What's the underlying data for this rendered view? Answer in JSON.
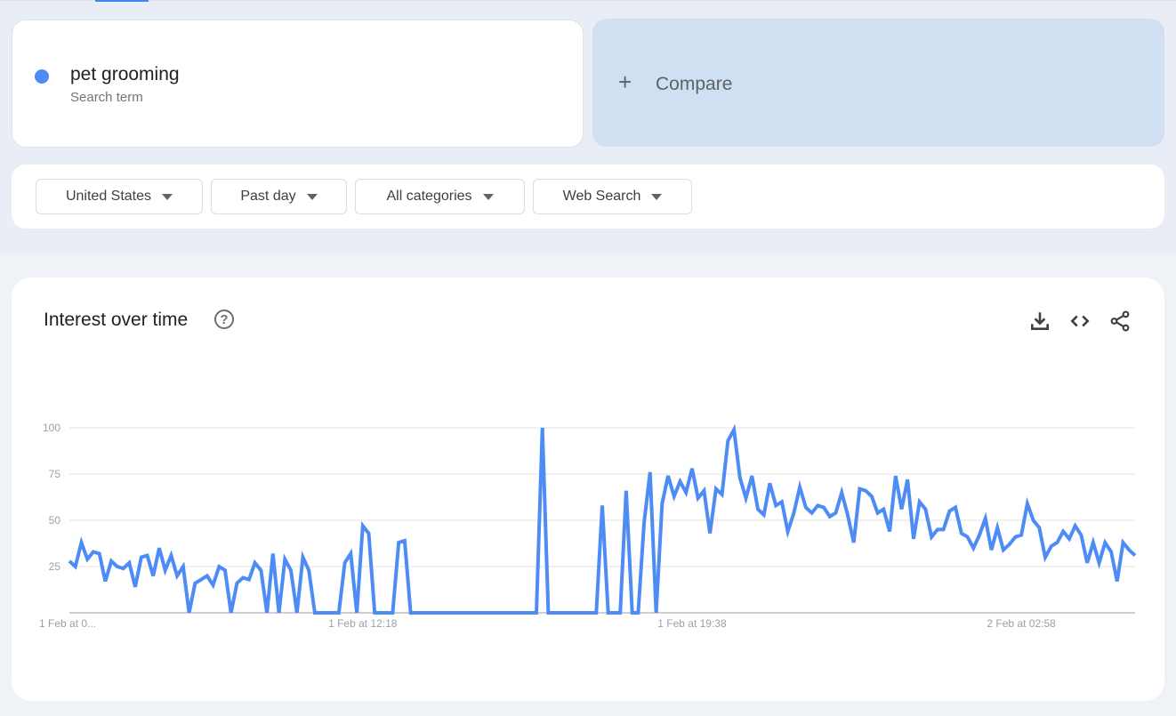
{
  "search_term": {
    "name": "pet grooming",
    "subtitle": "Search term",
    "color": "#4e8cf5"
  },
  "compare": {
    "icon": "plus-icon",
    "label": "Compare"
  },
  "filters": [
    {
      "label": "United States"
    },
    {
      "label": "Past day"
    },
    {
      "label": "All categories"
    },
    {
      "label": "Web Search"
    }
  ],
  "chart_panel": {
    "title": "Interest over time",
    "help_icon": "help-circle-icon",
    "actions": [
      {
        "icon": "download-icon"
      },
      {
        "icon": "embed-code-icon"
      },
      {
        "icon": "share-icon"
      }
    ]
  },
  "chart_data": {
    "type": "line",
    "title": "Interest over time",
    "xlabel": "",
    "ylabel": "",
    "ylim": [
      0,
      100
    ],
    "yticks": [
      25,
      50,
      75,
      100
    ],
    "grid": true,
    "x_tick_labels": [
      {
        "label": "1 Feb at 0...",
        "index": 0
      },
      {
        "label": "1 Feb at 12:18",
        "index": 49
      },
      {
        "label": "1 Feb at 19:38",
        "index": 104
      },
      {
        "label": "2 Feb at 02:58",
        "index": 159
      }
    ],
    "series": [
      {
        "name": "pet grooming",
        "color": "#4e8cf5",
        "values": [
          28,
          25,
          38,
          29,
          33,
          32,
          17,
          28,
          25,
          24,
          27,
          14,
          30,
          31,
          20,
          35,
          23,
          31,
          20,
          25,
          0,
          16,
          18,
          20,
          15,
          25,
          23,
          0,
          16,
          19,
          18,
          27,
          23,
          0,
          32,
          0,
          29,
          23,
          0,
          30,
          23,
          0,
          0,
          0,
          0,
          0,
          27,
          32,
          0,
          47,
          43,
          0,
          0,
          0,
          0,
          38,
          39,
          0,
          0,
          0,
          0,
          0,
          0,
          0,
          0,
          0,
          0,
          0,
          0,
          0,
          0,
          0,
          0,
          0,
          0,
          0,
          0,
          0,
          0,
          100,
          0,
          0,
          0,
          0,
          0,
          0,
          0,
          0,
          0,
          58,
          0,
          0,
          0,
          66,
          0,
          0,
          49,
          76,
          0,
          59,
          74,
          63,
          71,
          65,
          78,
          62,
          66,
          43,
          67,
          64,
          93,
          99,
          73,
          62,
          74,
          56,
          53,
          70,
          58,
          60,
          44,
          54,
          68,
          57,
          54,
          58,
          57,
          52,
          54,
          65,
          53,
          38,
          67,
          66,
          63,
          54,
          56,
          44,
          74,
          56,
          72,
          40,
          60,
          56,
          41,
          45,
          45,
          55,
          57,
          43,
          41,
          35,
          42,
          51,
          34,
          46,
          34,
          37,
          41,
          42,
          59,
          50,
          46,
          30,
          36,
          38,
          44,
          40,
          47,
          42,
          27,
          38,
          27,
          38,
          33,
          17,
          38,
          34,
          31
        ]
      }
    ]
  }
}
